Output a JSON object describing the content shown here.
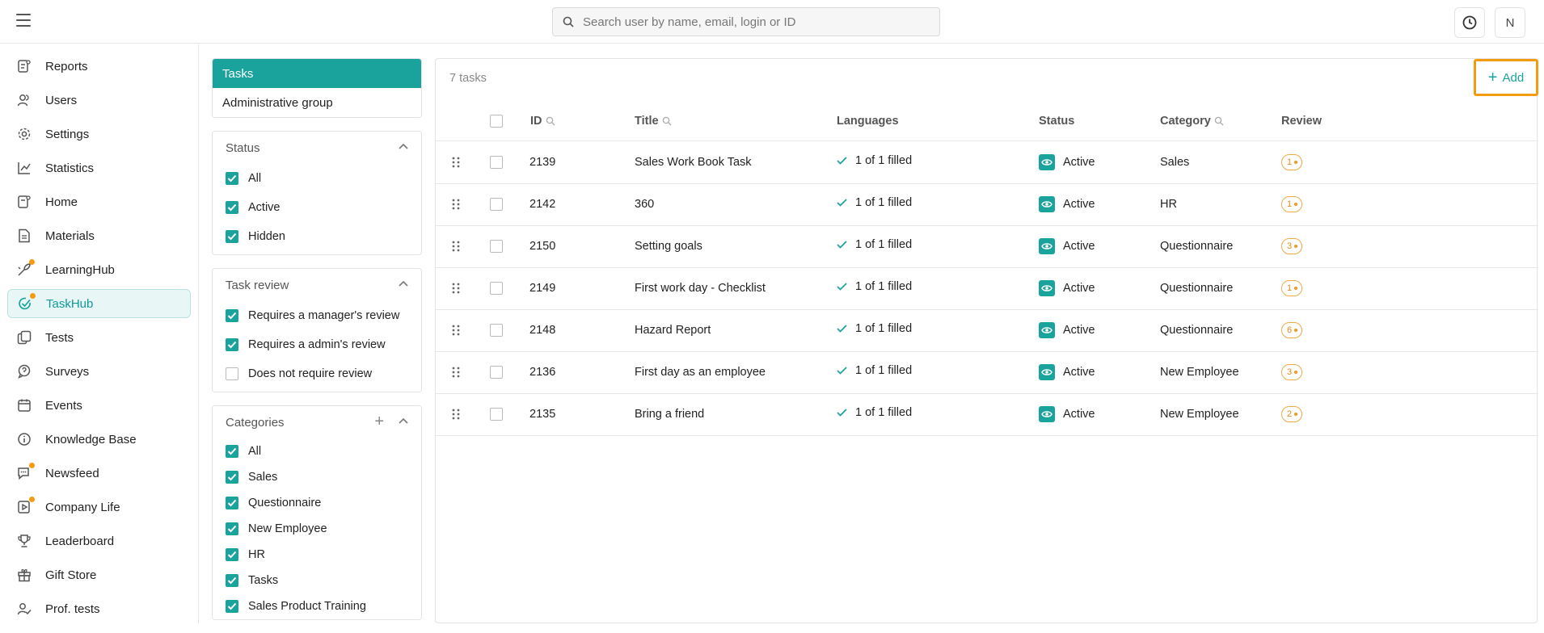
{
  "search": {
    "placeholder": "Search user by name, email, login or ID"
  },
  "header": {
    "avatar_initial": "N"
  },
  "colors": {
    "accent": "#1aa39d",
    "highlight": "#f39c12"
  },
  "sidebar": {
    "items": [
      {
        "label": "Reports",
        "icon": "reports-icon"
      },
      {
        "label": "Users",
        "icon": "users-icon"
      },
      {
        "label": "Settings",
        "icon": "gear-icon"
      },
      {
        "label": "Statistics",
        "icon": "chart-line-icon"
      },
      {
        "label": "Home",
        "icon": "home-icon"
      },
      {
        "label": "Materials",
        "icon": "document-icon"
      },
      {
        "label": "LearningHub",
        "icon": "learning-icon"
      },
      {
        "label": "TaskHub",
        "icon": "task-check-icon"
      },
      {
        "label": "Tests",
        "icon": "tests-icon"
      },
      {
        "label": "Surveys",
        "icon": "survey-icon"
      },
      {
        "label": "Events",
        "icon": "calendar-icon"
      },
      {
        "label": "Knowledge Base",
        "icon": "info-icon"
      },
      {
        "label": "Newsfeed",
        "icon": "chat-icon"
      },
      {
        "label": "Company Life",
        "icon": "video-icon"
      },
      {
        "label": "Leaderboard",
        "icon": "trophy-icon"
      },
      {
        "label": "Gift Store",
        "icon": "gift-icon"
      },
      {
        "label": "Prof. tests",
        "icon": "user-check-icon"
      }
    ],
    "active": "TaskHub"
  },
  "groups": {
    "items": [
      "Tasks",
      "Administrative group"
    ]
  },
  "filters": {
    "status": {
      "title": "Status",
      "options": [
        {
          "label": "All",
          "checked": true
        },
        {
          "label": "Active",
          "checked": true
        },
        {
          "label": "Hidden",
          "checked": true
        }
      ]
    },
    "review": {
      "title": "Task review",
      "options": [
        {
          "label": "Requires a manager's review",
          "checked": true
        },
        {
          "label": "Requires a admin's review",
          "checked": true
        },
        {
          "label": "Does not require review",
          "checked": false
        }
      ]
    },
    "categories": {
      "title": "Categories",
      "options": [
        {
          "label": "All",
          "checked": true
        },
        {
          "label": "Sales",
          "checked": true
        },
        {
          "label": "Questionnaire",
          "checked": true
        },
        {
          "label": "New Employee",
          "checked": true
        },
        {
          "label": "HR",
          "checked": true
        },
        {
          "label": "Tasks",
          "checked": true
        },
        {
          "label": "Sales Product Training",
          "checked": true
        }
      ]
    }
  },
  "table": {
    "count_label": "7 tasks",
    "add_label": "Add",
    "columns": [
      "ID",
      "Title",
      "Languages",
      "Status",
      "Category",
      "Review"
    ],
    "rows": [
      {
        "id": "2139",
        "title": "Sales Work Book Task",
        "languages": "1 of 1 filled",
        "status": "Active",
        "category": "Sales",
        "review": "1"
      },
      {
        "id": "2142",
        "title": "360",
        "languages": "1 of 1 filled",
        "status": "Active",
        "category": "HR",
        "review": "1"
      },
      {
        "id": "2150",
        "title": "Setting goals",
        "languages": "1 of 1 filled",
        "status": "Active",
        "category": "Questionnaire",
        "review": "3"
      },
      {
        "id": "2149",
        "title": "First work day - Checklist",
        "languages": "1 of 1 filled",
        "status": "Active",
        "category": "Questionnaire",
        "review": "1"
      },
      {
        "id": "2148",
        "title": "Hazard Report",
        "languages": "1 of 1 filled",
        "status": "Active",
        "category": "Questionnaire",
        "review": "6"
      },
      {
        "id": "2136",
        "title": "First day as an employee",
        "languages": "1 of 1 filled",
        "status": "Active",
        "category": "New Employee",
        "review": "3"
      },
      {
        "id": "2135",
        "title": "Bring a friend",
        "languages": "1 of 1 filled",
        "status": "Active",
        "category": "New Employee",
        "review": "2"
      }
    ]
  }
}
